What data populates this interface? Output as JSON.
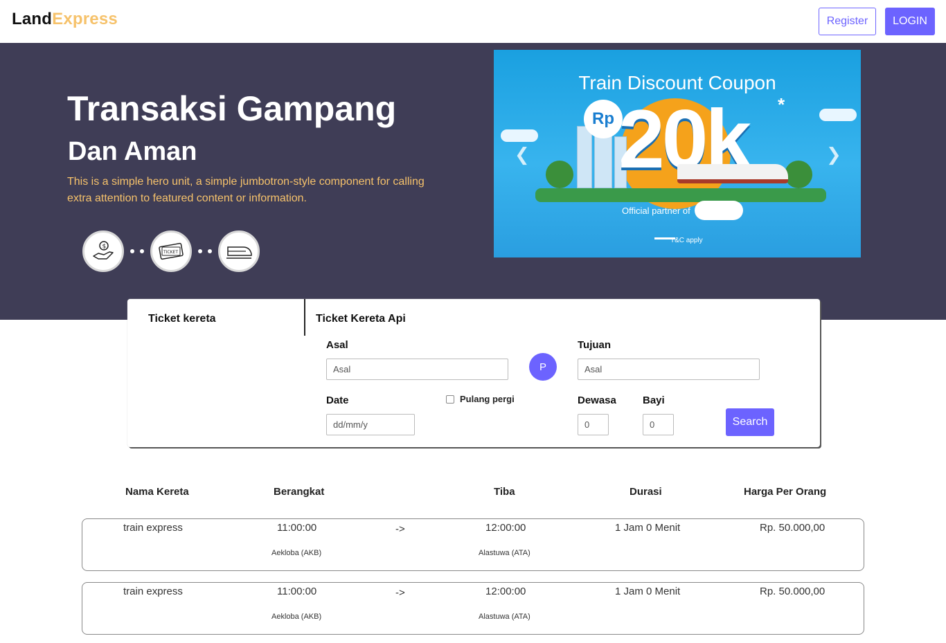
{
  "navbar": {
    "brand_part1": "Land",
    "brand_part2": "Express",
    "register_label": "Register",
    "login_label": "LOGIN"
  },
  "hero": {
    "title": "Transaksi Gampang",
    "subtitle": "Dan Aman",
    "description": "This is a simple hero unit, a simple jumbotron-style component for calling extra attention to featured content or information.",
    "step_icons": [
      "money-hand-icon",
      "ticket-icon",
      "train-icon"
    ],
    "ticket_icon_text": "TICKET"
  },
  "carousel": {
    "title": "Train Discount Coupon",
    "currency": "Rp",
    "amount": "20k",
    "asterisk": "*",
    "partner_text": "Official partner of",
    "tnc": "T&C apply"
  },
  "ticket_form": {
    "tab_left": "Ticket kereta",
    "tab_right": "Ticket Kereta Api",
    "asal_label": "Asal",
    "asal_placeholder": "Asal",
    "swap_label": "P",
    "tujuan_label": "Tujuan",
    "tujuan_placeholder": "Asal",
    "date_label": "Date",
    "date_placeholder": "dd/mm/y",
    "roundtrip_label": "Pulang pergi",
    "dewasa_label": "Dewasa",
    "dewasa_value": "0",
    "bayi_label": "Bayi",
    "bayi_value": "0",
    "search_label": "Search"
  },
  "results": {
    "headers": [
      "Nama Kereta",
      "Berangkat",
      "Tiba",
      "Durasi",
      "Harga Per Orang"
    ],
    "rows": [
      {
        "name": "train express",
        "depart_time": "11:00:00",
        "depart_station": "Aekloba (AKB)",
        "arrow": "->",
        "arrive_time": "12:00:00",
        "arrive_station": "Alastuwa (ATA)",
        "duration": "1 Jam 0 Menit",
        "price": "Rp. 50.000,00"
      },
      {
        "name": "train express",
        "depart_time": "11:00:00",
        "depart_station": "Aekloba (AKB)",
        "arrow": "->",
        "arrive_time": "12:00:00",
        "arrive_station": "Alastuwa (ATA)",
        "duration": "1 Jam 0 Menit",
        "price": "Rp. 50.000,00"
      }
    ]
  },
  "colors": {
    "accent": "#6c63ff",
    "hero_bg": "#3f3d56",
    "brand_accent": "#f6c26b",
    "carousel_bg": "#1aa0e0"
  }
}
